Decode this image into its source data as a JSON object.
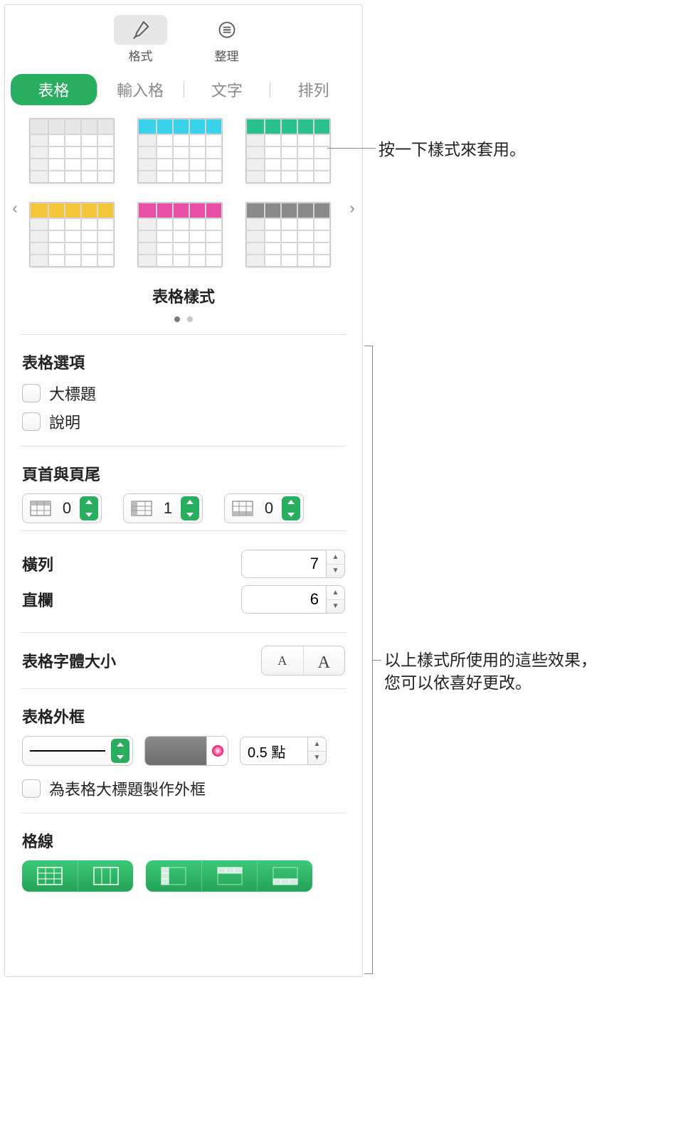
{
  "toolbar": {
    "format": "格式",
    "organize": "整理"
  },
  "tabs": {
    "table": "表格",
    "cell": "輸入格",
    "text": "文字",
    "arrange": "排列"
  },
  "styles": {
    "title": "表格樣式",
    "thumbs": [
      {
        "hdr": "#e8e8e8"
      },
      {
        "hdr": "#39d2ea"
      },
      {
        "hdr": "#2bc18d"
      },
      {
        "hdr": "#f5c63a"
      },
      {
        "hdr": "#e84fa6"
      },
      {
        "hdr": "#8a8a8a"
      }
    ]
  },
  "options": {
    "heading": "表格選項",
    "title_cb": "大標題",
    "caption_cb": "說明"
  },
  "headersFooters": {
    "heading": "頁首與頁尾",
    "vals": [
      "0",
      "1",
      "0"
    ]
  },
  "rows": {
    "label": "橫列",
    "value": "7"
  },
  "cols": {
    "label": "直欄",
    "value": "6"
  },
  "fontSize": {
    "label": "表格字體大小"
  },
  "outline": {
    "heading": "表格外框",
    "pt": "0.5 點",
    "cb": "為表格大標題製作外框"
  },
  "gridlines": {
    "heading": "格線"
  },
  "callouts": {
    "c1": "按一下樣式來套用。",
    "c2a": "以上樣式所使用的這些效果，",
    "c2b": "您可以依喜好更改。"
  }
}
